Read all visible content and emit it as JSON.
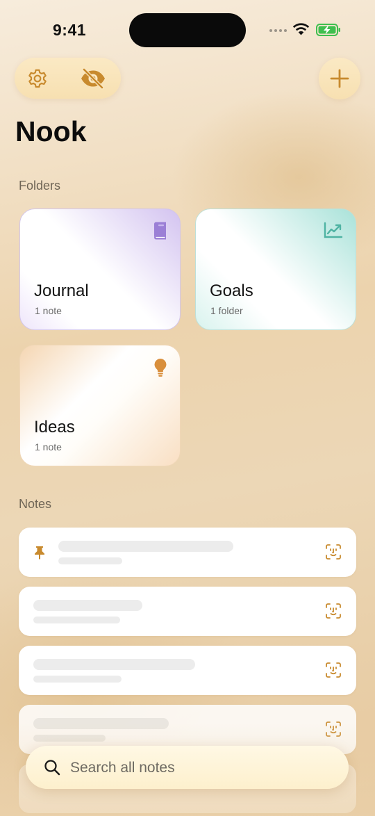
{
  "status_bar": {
    "time": "9:41"
  },
  "header": {
    "settings_icon": "gear-icon",
    "visibility_icon": "eye-off-icon",
    "add_icon": "plus-icon",
    "title": "Nook"
  },
  "folders_section": {
    "label": "Folders",
    "items": [
      {
        "name": "Journal",
        "count": "1 note",
        "icon": "book-icon",
        "accent": "#9b7fd6"
      },
      {
        "name": "Goals",
        "count": "1 folder",
        "icon": "chart-line-icon",
        "accent": "#4fb3a3"
      },
      {
        "name": "Ideas",
        "count": "1 note",
        "icon": "lightbulb-icon",
        "accent": "#d98f3c"
      }
    ]
  },
  "notes_section": {
    "label": "Notes",
    "items": [
      {
        "pinned": true,
        "locked": true
      },
      {
        "pinned": false,
        "locked": true
      },
      {
        "pinned": false,
        "locked": true
      },
      {
        "pinned": false,
        "locked": true
      }
    ]
  },
  "search": {
    "placeholder": "Search all notes",
    "icon": "search-icon"
  },
  "colors": {
    "accent": "#c88a2e",
    "background": "#ecd3ad"
  }
}
